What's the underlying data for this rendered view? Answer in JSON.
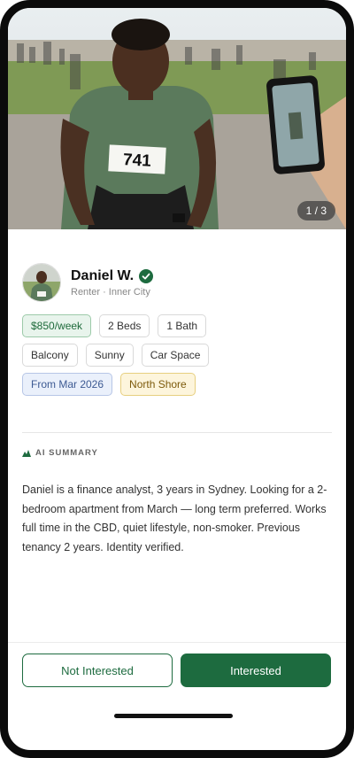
{
  "photo": {
    "counter": "1 / 3",
    "bib_number": "741"
  },
  "profile": {
    "name": "Daniel W.",
    "subtitle": "Renter · Inner City"
  },
  "tags": [
    [
      "$850/week",
      "2 Beds",
      "1 Bath"
    ],
    [
      "Balcony",
      "Sunny",
      "Car Space"
    ],
    [
      "From Mar 2026",
      "North Shore"
    ]
  ],
  "ai_summary": {
    "label": "AI SUMMARY",
    "text": "Daniel is a finance analyst, 3 years in Sydney. Looking for a 2-bedroom apartment from March — long term preferred. Works full time in the CBD, quiet lifestyle, non-smoker. Previous tenancy 2 years. Identity verified."
  },
  "actions": {
    "not_interested": "Not Interested",
    "interested": "Interested"
  },
  "colors": {
    "accent": "#1d6b3f"
  }
}
